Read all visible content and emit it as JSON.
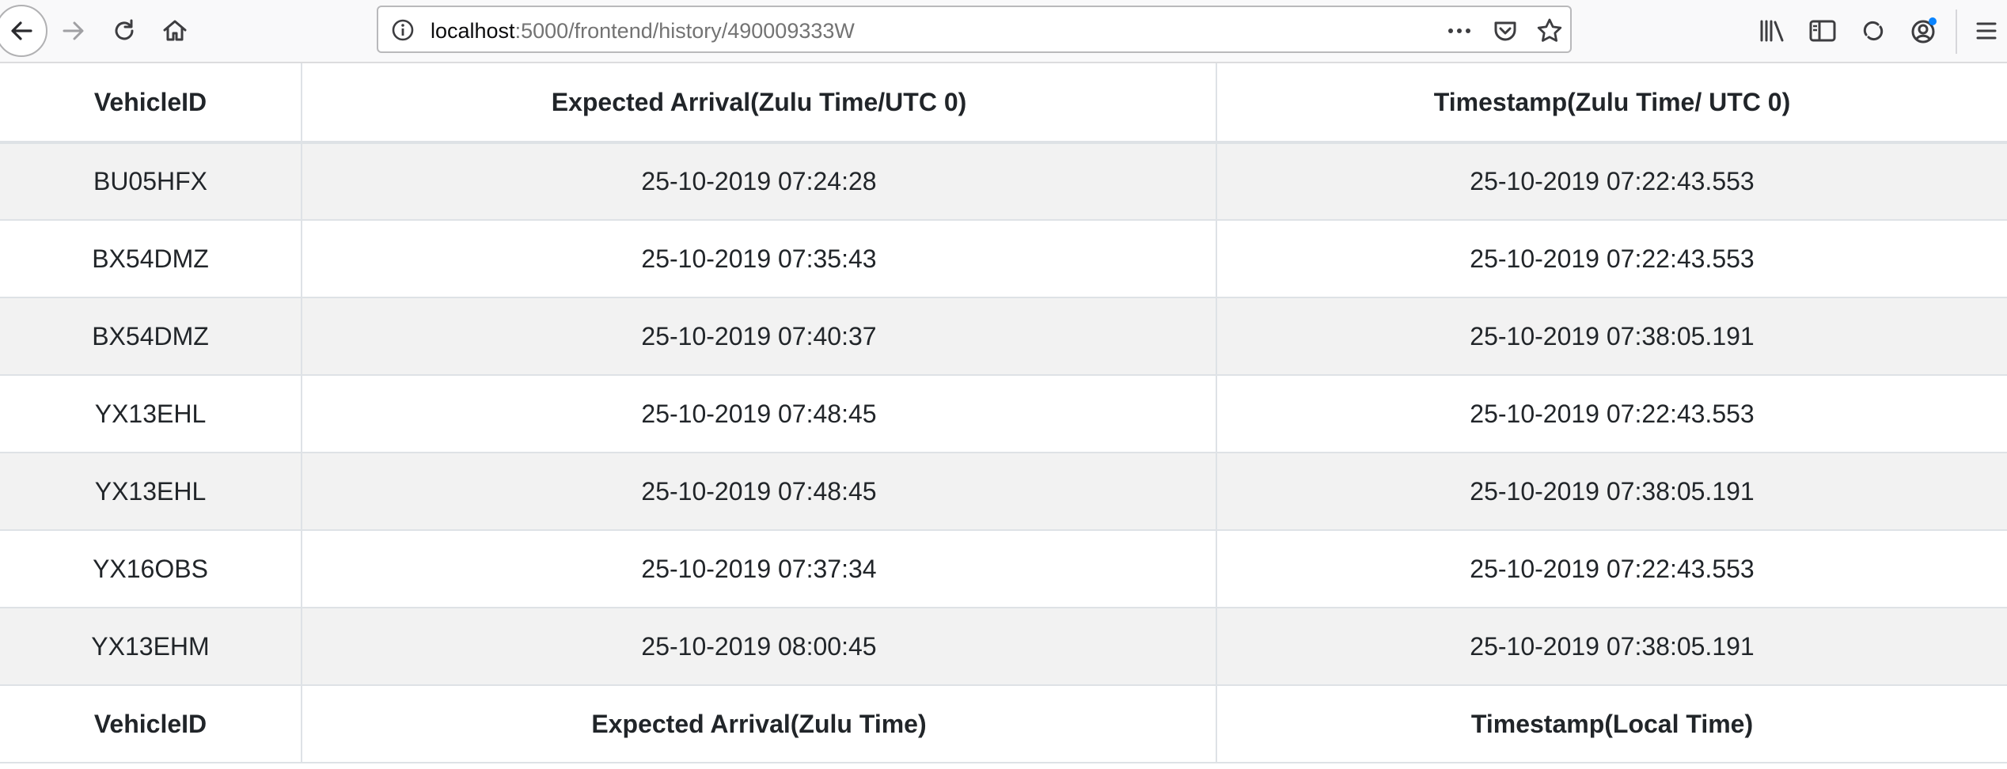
{
  "browser": {
    "url_host": "localhost",
    "url_rest": ":5000/frontend/history/490009333W",
    "icons": {
      "back": "arrow-left-icon",
      "forward": "arrow-right-icon",
      "reload": "reload-icon",
      "home": "home-icon",
      "info": "info-icon",
      "more": "more-dots-icon",
      "pocket": "pocket-icon",
      "bookmark": "star-icon",
      "library": "library-icon",
      "sidebar": "sidebar-icon",
      "sync": "sync-icon",
      "account": "account-icon",
      "menu": "hamburger-menu-icon"
    }
  },
  "table": {
    "header": [
      "VehicleID",
      "Expected Arrival(Zulu Time/UTC 0)",
      "Timestamp(Zulu Time/ UTC 0)"
    ],
    "rows": [
      [
        "BU05HFX",
        "25-10-2019 07:24:28",
        "25-10-2019 07:22:43.553"
      ],
      [
        "BX54DMZ",
        "25-10-2019 07:35:43",
        "25-10-2019 07:22:43.553"
      ],
      [
        "BX54DMZ",
        "25-10-2019 07:40:37",
        "25-10-2019 07:38:05.191"
      ],
      [
        "YX13EHL",
        "25-10-2019 07:48:45",
        "25-10-2019 07:22:43.553"
      ],
      [
        "YX13EHL",
        "25-10-2019 07:48:45",
        "25-10-2019 07:38:05.191"
      ],
      [
        "YX16OBS",
        "25-10-2019 07:37:34",
        "25-10-2019 07:22:43.553"
      ],
      [
        "YX13EHM",
        "25-10-2019 08:00:45",
        "25-10-2019 07:38:05.191"
      ]
    ],
    "footer": [
      "VehicleID",
      "Expected Arrival(Zulu Time)",
      "Timestamp(Local Time)"
    ]
  },
  "colors": {
    "toolbar_bg": "#f9f9fa",
    "stripe": "#f2f2f2",
    "border": "#dee2e6",
    "text": "#212529",
    "sync_dot": "#0a84ff"
  }
}
